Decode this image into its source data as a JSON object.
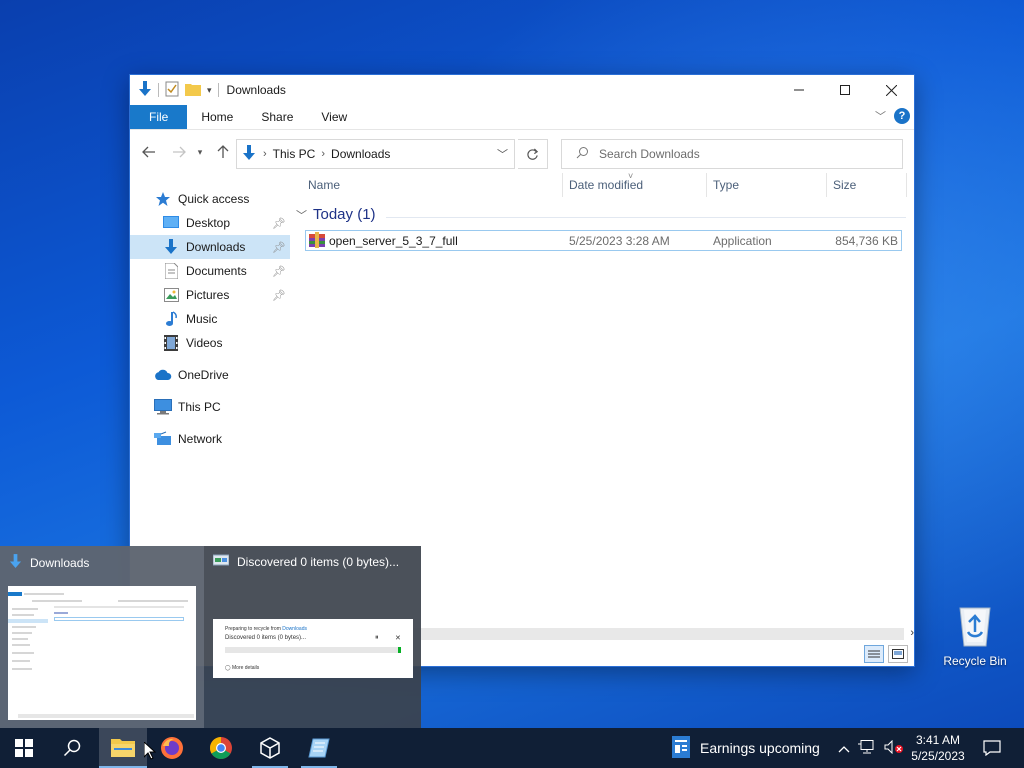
{
  "window": {
    "title": "Downloads",
    "tabs": {
      "file": "File",
      "home": "Home",
      "share": "Share",
      "view": "View"
    },
    "address": {
      "crumb1": "This PC",
      "crumb2": "Downloads"
    },
    "search_placeholder": "Search Downloads"
  },
  "nav": {
    "quick_access": "Quick access",
    "desktop": "Desktop",
    "downloads": "Downloads",
    "documents": "Documents",
    "pictures": "Pictures",
    "music": "Music",
    "videos": "Videos",
    "onedrive": "OneDrive",
    "this_pc": "This PC",
    "network": "Network"
  },
  "columns": {
    "name": "Name",
    "date": "Date modified",
    "type": "Type",
    "size": "Size"
  },
  "group": {
    "label": "Today (1)"
  },
  "files": [
    {
      "name": "open_server_5_3_7_full",
      "date": "5/25/2023 3:28 AM",
      "type": "Application",
      "size": "854,736 KB"
    }
  ],
  "thumbnails": {
    "explorer_title": "Downloads",
    "delete_title": "Discovered 0 items (0 bytes)...",
    "delete_prep": "Preparing to recycle from ",
    "delete_prep_link": "Downloads",
    "delete_status": "Discovered 0 items (0 bytes)...",
    "delete_more": "More details"
  },
  "desktop": {
    "recycle_bin": "Recycle Bin"
  },
  "taskbar": {
    "news": "Earnings upcoming",
    "time": "3:41 AM",
    "date": "5/25/2023"
  },
  "colors": {
    "accent": "#1979ca",
    "selection": "#cce4f7",
    "taskbar": "#101f36"
  }
}
